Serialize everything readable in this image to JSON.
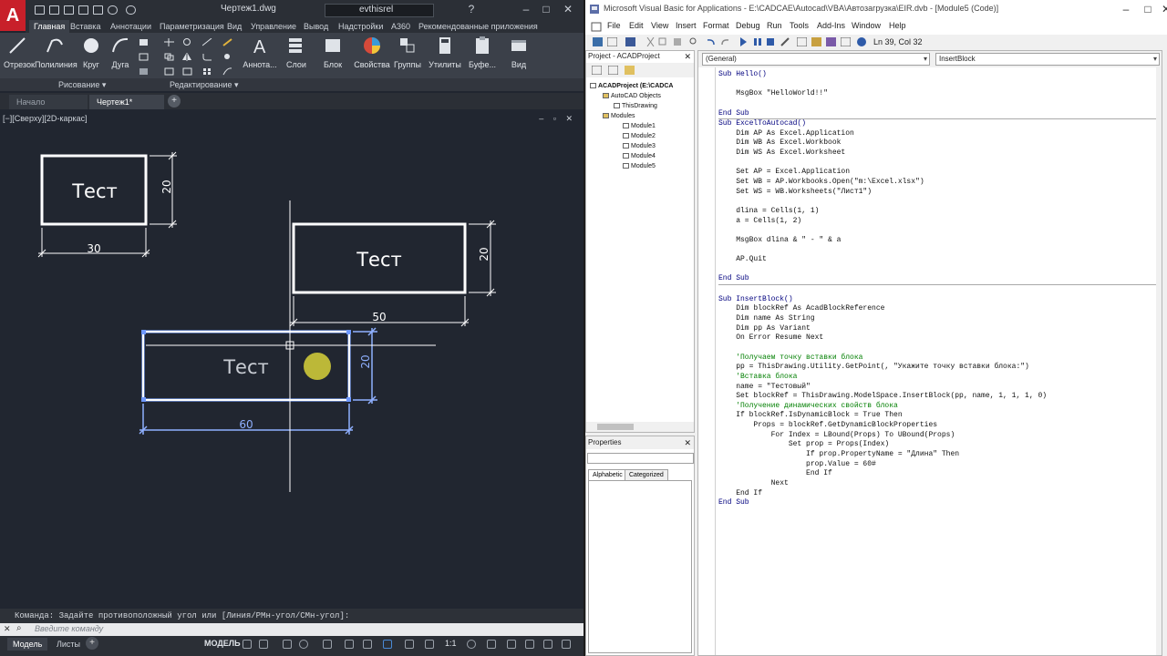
{
  "acad": {
    "logo": "A",
    "doc_title": "Чертеж1.dwg",
    "user": "evthisrel",
    "tabs": [
      "Главная",
      "Вставка",
      "Аннотации",
      "Параметризация",
      "Вид",
      "Управление",
      "Вывод",
      "Надстройки",
      "A360",
      "Рекомендованные приложения"
    ],
    "ribbon_buttons": [
      "Отрезок",
      "Полилиния",
      "Круг",
      "Дуга",
      "Аннота...",
      "Слои",
      "Блок",
      "Свойства",
      "Группы",
      "Утилиты",
      "Буфе...",
      "Вид"
    ],
    "panel_labels": [
      "Рисование ▾",
      "Редактирование ▾"
    ],
    "file_tabs": [
      "Начало",
      "Чертеж1*"
    ],
    "viewport_label": "[−][Сверху][2D-каркас]",
    "drawing": {
      "block1_text": "Тест",
      "block1_w": "30",
      "block1_h": "20",
      "block2_text": "Тест",
      "block2_w": "50",
      "block2_h": "20",
      "block3_text": "Тест",
      "block3_w": "60",
      "block3_h": "20"
    },
    "command_history": "Команда: Задайте противоположный угол или [Линия/РМн-угол/СМн-угол]:",
    "command_placeholder": "Введите команду",
    "layout_tabs": [
      "Модель",
      "Листы"
    ],
    "status_model": "МОДЕЛЬ",
    "status_scale": "1:1"
  },
  "vba": {
    "title": "Microsoft Visual Basic for Applications - E:\\CADCAE\\Autocad\\VBA\\Автозагрузка\\EIR.dvb - [Module5 (Code)]",
    "menu": [
      "File",
      "Edit",
      "View",
      "Insert",
      "Format",
      "Debug",
      "Run",
      "Tools",
      "Add-Ins",
      "Window",
      "Help"
    ],
    "ln_col": "Ln 39, Col 32",
    "project_title": "Project - ACADProject",
    "tree": [
      "ACADProject (E:\\CADCA",
      "AutoCAD Objects",
      "ThisDrawing",
      "Modules",
      "Module1",
      "Module2",
      "Module3",
      "Module4",
      "Module5"
    ],
    "properties_title": "Properties",
    "prop_tabs": [
      "Alphabetic",
      "Categorized"
    ],
    "combo_left": "(General)",
    "combo_right": "InsertBlock",
    "code": [
      {
        "t": "Sub Hello()",
        "c": "kw"
      },
      {
        "t": "",
        "c": ""
      },
      {
        "t": "    MsgBox \"HelloWorld!!\"",
        "c": ""
      },
      {
        "t": "",
        "c": ""
      },
      {
        "t": "End Sub",
        "c": "kw"
      },
      {
        "t": "---",
        "c": "sep"
      },
      {
        "t": "Sub ExcelToAutocad()",
        "c": "kw"
      },
      {
        "t": "    Dim AP As Excel.Application",
        "c": ""
      },
      {
        "t": "    Dim WB As Excel.Workbook",
        "c": ""
      },
      {
        "t": "    Dim WS As Excel.Worksheet",
        "c": ""
      },
      {
        "t": "",
        "c": ""
      },
      {
        "t": "    Set AP = Excel.Application",
        "c": ""
      },
      {
        "t": "    Set WB = AP.Workbooks.Open(\"m:\\Excel.xlsx\")",
        "c": ""
      },
      {
        "t": "    Set WS = WB.Worksheets(\"Лист1\")",
        "c": ""
      },
      {
        "t": "",
        "c": ""
      },
      {
        "t": "    dlina = Cells(1, 1)",
        "c": ""
      },
      {
        "t": "    a = Cells(1, 2)",
        "c": ""
      },
      {
        "t": "",
        "c": ""
      },
      {
        "t": "    MsgBox dlina & \" - \" & a",
        "c": ""
      },
      {
        "t": "",
        "c": ""
      },
      {
        "t": "    AP.Quit",
        "c": ""
      },
      {
        "t": "",
        "c": ""
      },
      {
        "t": "End Sub",
        "c": "kw"
      },
      {
        "t": "---",
        "c": "sep"
      },
      {
        "t": "",
        "c": ""
      },
      {
        "t": "Sub InsertBlock()",
        "c": "kw"
      },
      {
        "t": "    Dim blockRef As AcadBlockReference",
        "c": ""
      },
      {
        "t": "    Dim name As String",
        "c": ""
      },
      {
        "t": "    Dim pp As Variant",
        "c": ""
      },
      {
        "t": "    On Error Resume Next",
        "c": ""
      },
      {
        "t": "",
        "c": ""
      },
      {
        "t": "    'Получаем точку вставки блока",
        "c": "cm"
      },
      {
        "t": "    pp = ThisDrawing.Utility.GetPoint(, \"Укажите точку вставки блока:\")",
        "c": ""
      },
      {
        "t": "    'Вставка блока",
        "c": "cm"
      },
      {
        "t": "    name = \"Тестовый\"",
        "c": ""
      },
      {
        "t": "    Set blockRef = ThisDrawing.ModelSpace.InsertBlock(pp, name, 1, 1, 1, 0)",
        "c": ""
      },
      {
        "t": "    'Получение динамических свойств блока",
        "c": "cm"
      },
      {
        "t": "    If blockRef.IsDynamicBlock = True Then",
        "c": ""
      },
      {
        "t": "        Props = blockRef.GetDynamicBlockProperties",
        "c": ""
      },
      {
        "t": "            For Index = LBound(Props) To UBound(Props)",
        "c": ""
      },
      {
        "t": "                Set prop = Props(Index)",
        "c": ""
      },
      {
        "t": "                    If prop.PropertyName = \"Длина\" Then",
        "c": ""
      },
      {
        "t": "                    prop.Value = 60#",
        "c": ""
      },
      {
        "t": "                    End If",
        "c": ""
      },
      {
        "t": "            Next",
        "c": ""
      },
      {
        "t": "    End If",
        "c": ""
      },
      {
        "t": "End Sub",
        "c": "kw"
      }
    ]
  }
}
